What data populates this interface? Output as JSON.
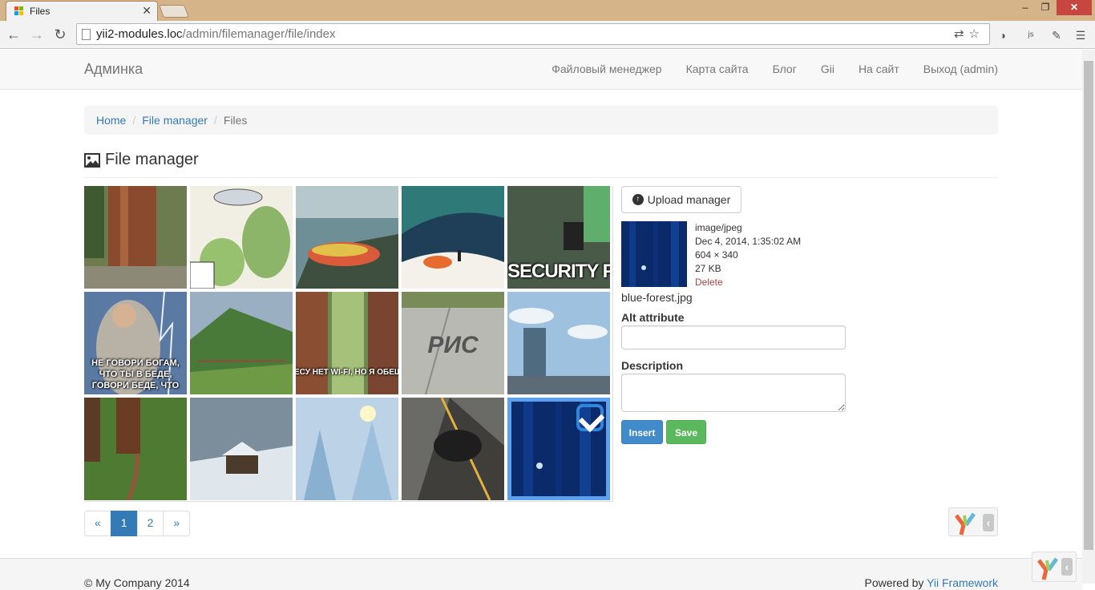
{
  "browser": {
    "tab_title": "Files",
    "url_domain": "yii2-modules.loc",
    "url_path": "/admin/filemanager/file/index"
  },
  "navbar": {
    "brand": "Админка",
    "items": [
      {
        "label": "Файловый менеджер"
      },
      {
        "label": "Карта сайта"
      },
      {
        "label": "Блог"
      },
      {
        "label": "Gii"
      },
      {
        "label": "На сайт"
      },
      {
        "label": "Выход (admin)"
      }
    ]
  },
  "breadcrumb": {
    "home": "Home",
    "section": "File manager",
    "current": "Files"
  },
  "page_title": "File manager",
  "thumbnails": [
    {
      "caption": ""
    },
    {
      "caption": ""
    },
    {
      "caption": ""
    },
    {
      "caption": ""
    },
    {
      "caption": "SECURITY FAI"
    },
    {
      "caption": "НЕ ГОВОРИ БОГАМ, ЧТО ТЫ В БЕДЕ, ГОВОРИ БЕДЕ, ЧТО"
    },
    {
      "caption": ""
    },
    {
      "caption": "ЕСУ НЕТ WI-FI, НО Я ОБЕЩА ВЫ НАЙДЕТЕ СВЯЗЬ ПОЛУЧ"
    },
    {
      "caption": "РИС"
    },
    {
      "caption": ""
    },
    {
      "caption": ""
    },
    {
      "caption": ""
    },
    {
      "caption": ""
    },
    {
      "caption": ""
    },
    {
      "caption": ""
    }
  ],
  "pagination": {
    "prev": "«",
    "pages": [
      "1",
      "2"
    ],
    "active": "1",
    "next": "»"
  },
  "panel": {
    "upload_label": "Upload manager",
    "mime": "image/jpeg",
    "date": "Dec 4, 2014, 1:35:02 AM",
    "dimensions": "604 × 340",
    "size": "27 KB",
    "delete_label": "Delete",
    "filename": "blue-forest.jpg",
    "alt_label": "Alt attribute",
    "alt_value": "",
    "description_label": "Description",
    "description_value": "",
    "insert_label": "Insert",
    "save_label": "Save"
  },
  "footer": {
    "left": "© My Company 2014",
    "right_prefix": "Powered by ",
    "right_link": "Yii Framework"
  },
  "colors": {
    "link": "#337ab7",
    "primary": "#428bca",
    "success": "#5cb85c",
    "selected_outline": "#5ba1f0",
    "danger": "#a94442"
  }
}
